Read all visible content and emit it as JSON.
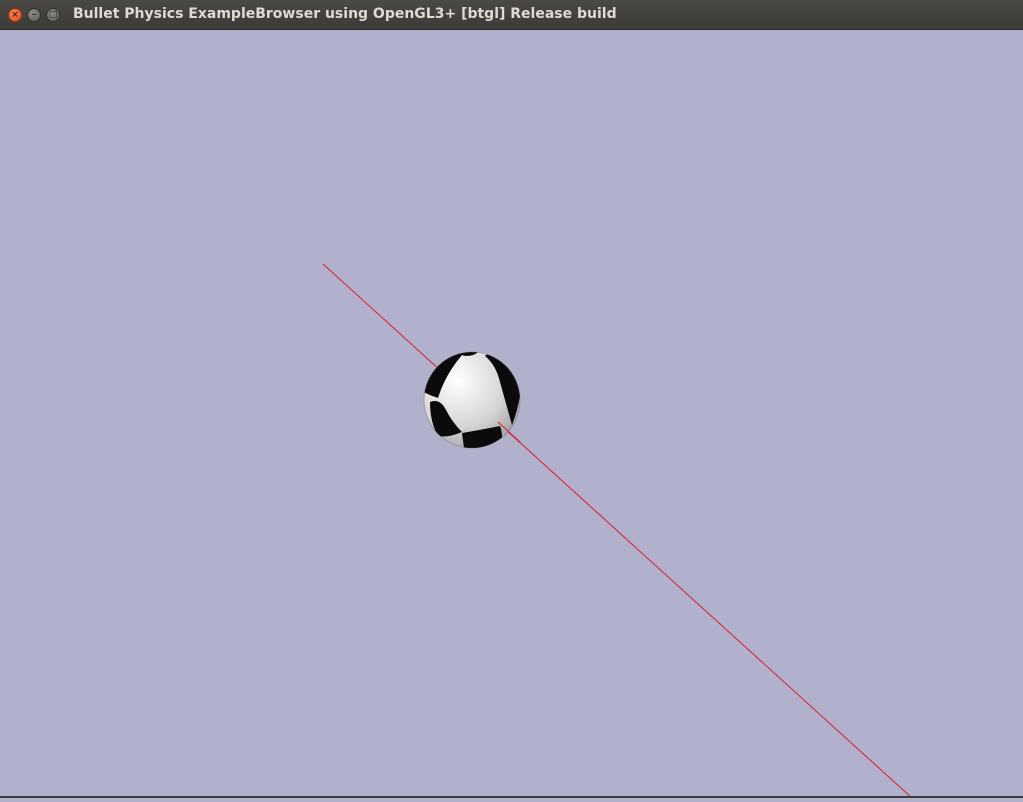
{
  "window": {
    "title": "Bullet Physics ExampleBrowser using OpenGL3+ [btgl] Release build",
    "controls": {
      "close_icon": "close-icon",
      "minimize_icon": "minimize-icon",
      "maximize_icon": "maximize-icon"
    }
  },
  "scene": {
    "background_color": "#b1b1cd",
    "line_color": "#e0192a",
    "sphere_pattern": "checkerboard black/white"
  }
}
